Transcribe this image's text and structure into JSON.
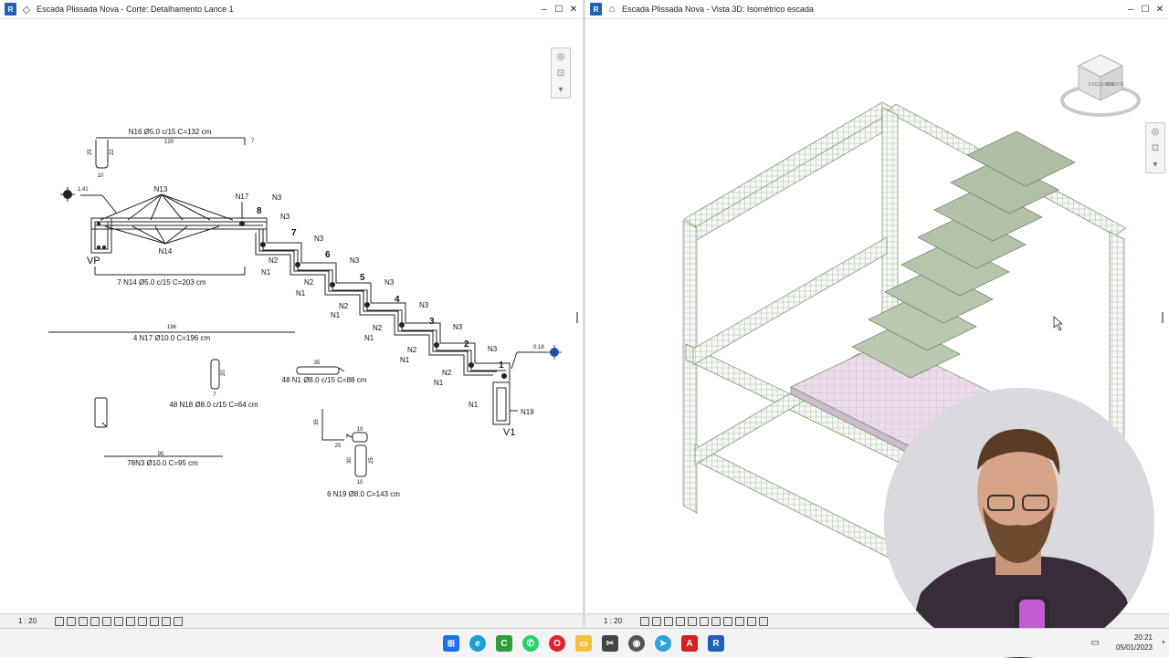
{
  "left_view": {
    "title": "Escada Plissada Nova - Corte: Detalhamento Lance 1",
    "scale": "1 : 20",
    "drawing": {
      "n16_label": "N16 Ø5.0 c/15 C=132 cm",
      "n16_len": "120",
      "n16_h1": "25",
      "n16_h2": "22",
      "n16_w": "10",
      "n16_tick": "7",
      "elev_left": "1.41",
      "n13": "N13",
      "n14": "N14",
      "n17_tag": "N17",
      "vp": "VP",
      "n14_label": "7 N14 Ø5.0 c/15 C=203 cm",
      "n17_len": "196",
      "n17_label": "4 N17 Ø10.0 C=196 cm",
      "n18_h": "20",
      "n18_w": "7",
      "n18_label": "48 N18 Ø8.0 c/15 C=64 cm",
      "n1_len": "35",
      "n1_label": "48 N1 Ø8.0 c/15 C=88 cm",
      "n3_len": "95",
      "n3_label": "78N3 Ø10.0 C=95 cm",
      "n19_d1": "35",
      "n19_d2": "10",
      "n19_d3": "25",
      "n19_d4": "7",
      "n19_d5": "30",
      "n19_d6": "25",
      "n19_d7": "10",
      "n19_label": "6 N19 Ø8.0 C=143 cm",
      "n3": "N3",
      "n2": "N2",
      "n1": "N1",
      "n19_tag": "N19",
      "v1": "V1",
      "elev_right": "0.18",
      "steps": [
        "8",
        "7",
        "6",
        "5",
        "4",
        "3",
        "2",
        "1"
      ]
    }
  },
  "right_view": {
    "title": "Escada Plissada Nova - Vista 3D: Isométrico escada",
    "scale": "1 : 20",
    "viewcube": {
      "left_face": "ESQUERDA",
      "right_face": "FRENTE"
    }
  },
  "window_controls": [
    "–",
    "☐",
    "✕"
  ],
  "taskbar": {
    "icons": [
      "windows-start",
      "edge",
      "camtasia",
      "whatsapp",
      "opera",
      "file-explorer",
      "snipping",
      "chrome",
      "telegram",
      "acrobat",
      "revit"
    ],
    "time": "20:21",
    "date": "05/01/2023"
  },
  "colors": {
    "revit_blue": "#1f61b7",
    "rebar_green": "#7fbf6a",
    "concrete_pink": "#e9d6e6"
  }
}
